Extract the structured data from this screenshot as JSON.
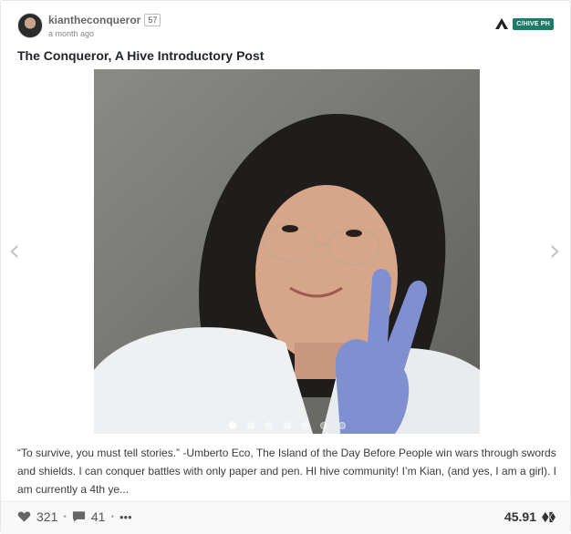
{
  "post": {
    "author": "kiantheconqueror",
    "reputation": "57",
    "time_ago": "a month ago",
    "community": "C/HIVE PH",
    "title": "The Conqueror, A Hive Introductory Post",
    "excerpt": "“To survive, you must tell stories.” -Umberto Eco, The Island of the Day Before People win wars through swords and shields. I can conquer battles with only paper and pen. HI hive community! I’m Kian, (and yes, I am a girl). I am currently a 4th ye...",
    "votes": "321",
    "comments": "41",
    "more": "•••",
    "payout": "45.91"
  },
  "carousel": {
    "prev_icon": "‹",
    "next_icon": "›",
    "dots": 7,
    "active_dot": 0
  },
  "colors": {
    "community_badge": "#1e7a69",
    "title": "#212529",
    "text": "#3b3b3b"
  },
  "icons": {
    "vote": "heart-icon",
    "comment": "comment-icon",
    "payout": "hive-icon",
    "community": "community-logo-icon",
    "prev": "chevron-left-icon",
    "next": "chevron-right-icon"
  }
}
